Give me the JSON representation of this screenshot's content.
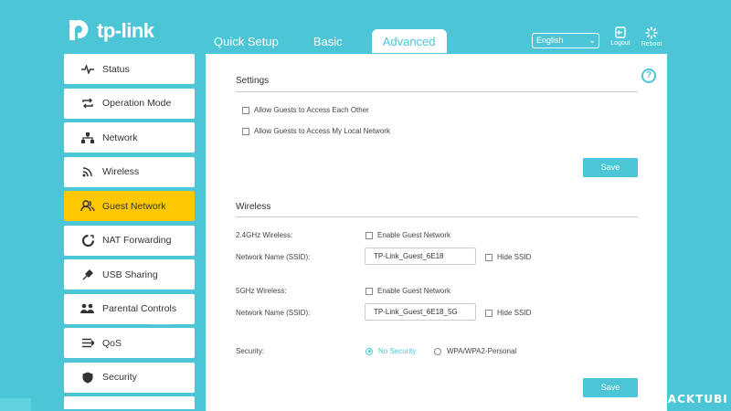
{
  "header": {
    "brand": "tp-link",
    "tabs": [
      {
        "label": "Quick Setup"
      },
      {
        "label": "Basic"
      },
      {
        "label": "Advanced",
        "active": true
      }
    ],
    "language": "English",
    "logout_label": "Logout",
    "reboot_label": "Reboot"
  },
  "sidebar": {
    "items": [
      {
        "label": "Status",
        "icon": "pulse-icon"
      },
      {
        "label": "Operation Mode",
        "icon": "cycle-icon"
      },
      {
        "label": "Network",
        "icon": "network-icon"
      },
      {
        "label": "Wireless",
        "icon": "wifi-icon"
      },
      {
        "label": "Guest Network",
        "icon": "guests-icon",
        "active": true
      },
      {
        "label": "NAT Forwarding",
        "icon": "nat-icon"
      },
      {
        "label": "USB Sharing",
        "icon": "usb-icon"
      },
      {
        "label": "Parental Controls",
        "icon": "family-icon"
      },
      {
        "label": "QoS",
        "icon": "qos-icon"
      },
      {
        "label": "Security",
        "icon": "shield-icon"
      }
    ]
  },
  "settings": {
    "title": "Settings",
    "allow_each_other": "Allow Guests to Access Each Other",
    "allow_local": "Allow Guests to Access My Local Network",
    "save_label": "Save"
  },
  "wireless": {
    "title": "Wireless",
    "band24_label": "2.4GHz Wireless:",
    "band24_enable": "Enable Guest Network",
    "ssid_label": "Network Name (SSID):",
    "ssid24_value": "TP-Link_Guest_6E18",
    "hide_ssid": "Hide SSID",
    "band5_label": "5GHz Wireless:",
    "band5_enable": "Enable Guest Network",
    "ssid5_value": "TP-Link_Guest_6E18_5G",
    "security_label": "Security:",
    "security_options": [
      "No Security",
      "WPA/WPA2-Personal"
    ],
    "security_selected": "No Security",
    "save_label": "Save"
  },
  "watermark": "BLACKTUBI",
  "colors": {
    "accent": "#4cc6d6",
    "active_nav": "#fdc800"
  }
}
